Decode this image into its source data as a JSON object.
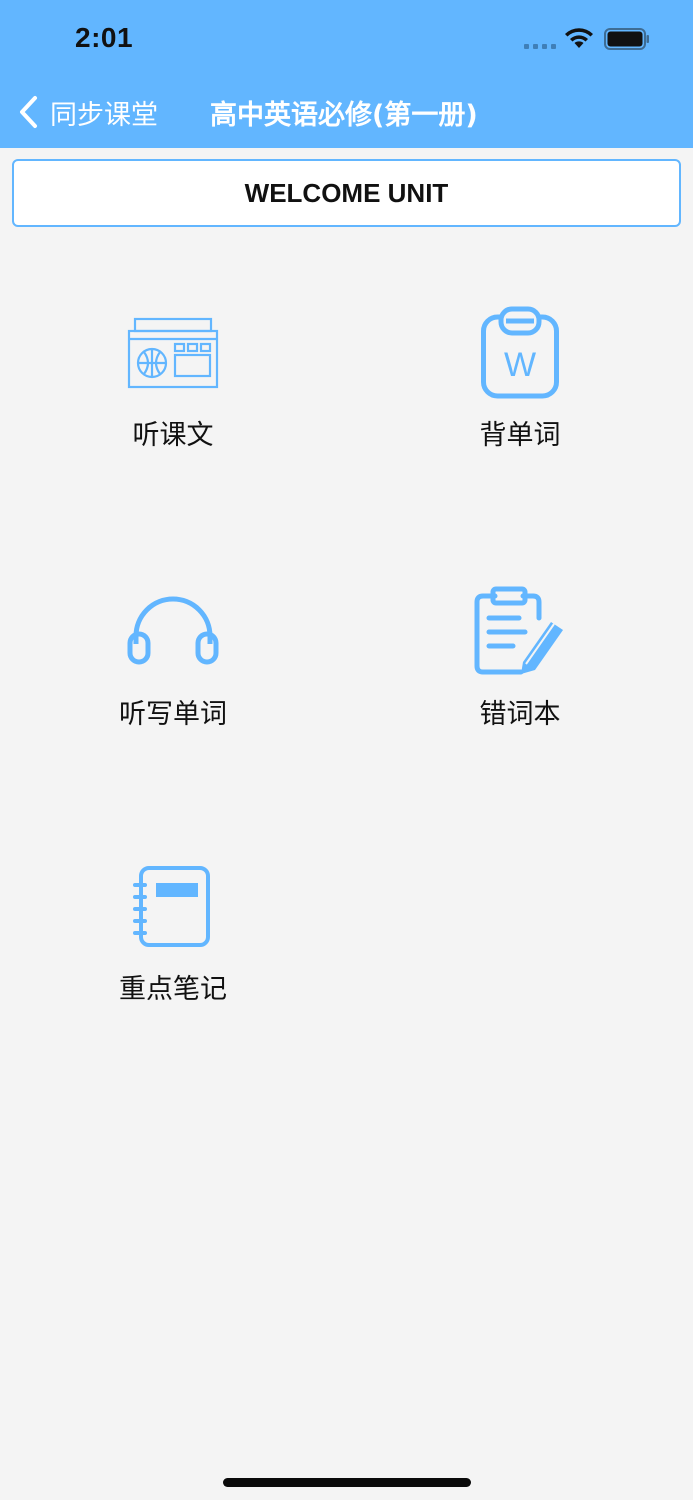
{
  "status_bar": {
    "time": "2:01"
  },
  "nav": {
    "back_label": "同步课堂",
    "title": "高中英语必修(第一册)"
  },
  "unit": {
    "label": "WELCOME UNIT"
  },
  "features": [
    {
      "label": "听课文",
      "icon": "radio-icon"
    },
    {
      "label": "背单词",
      "icon": "word-clipboard-icon"
    },
    {
      "label": "听写单词",
      "icon": "headphones-icon"
    },
    {
      "label": "错词本",
      "icon": "clipboard-edit-icon"
    },
    {
      "label": "重点笔记",
      "icon": "notebook-icon"
    }
  ],
  "colors": {
    "accent": "#62b6ff",
    "background": "#f4f4f4"
  }
}
